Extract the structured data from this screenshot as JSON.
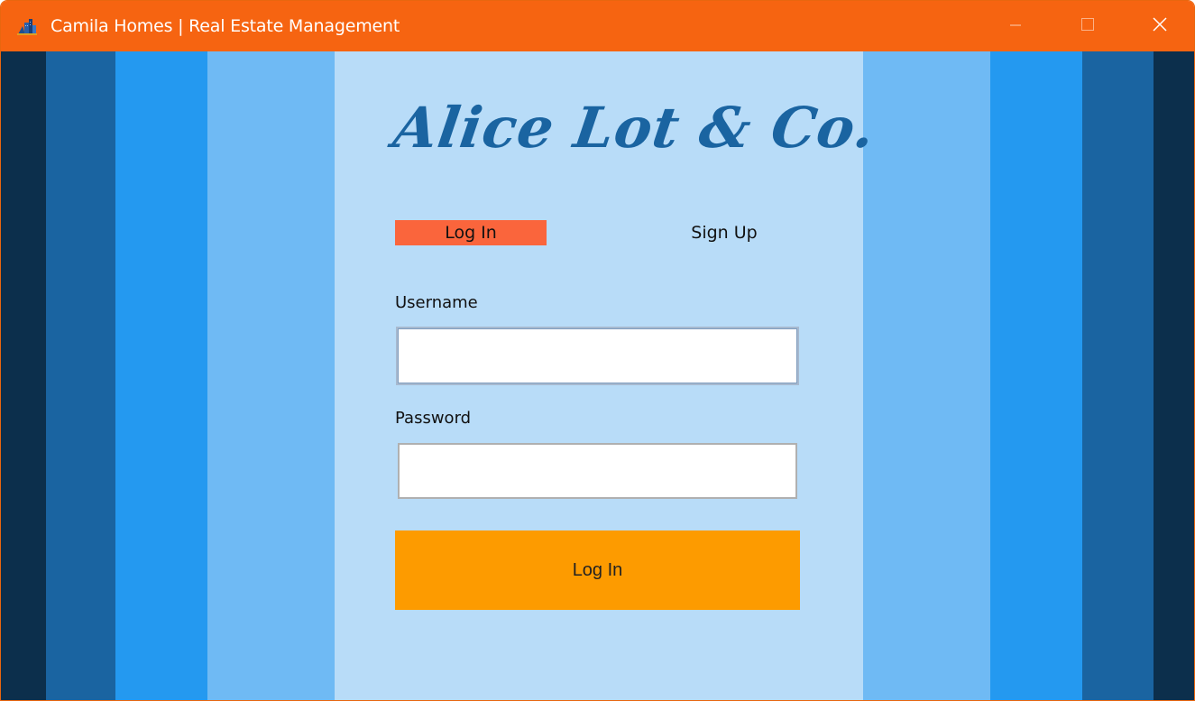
{
  "window": {
    "title": "Camila Homes | Real Estate Management",
    "controls": {
      "minimize_icon": "minimize-icon",
      "maximize_icon": "maximize-icon",
      "close_icon": "close-icon"
    },
    "accent_color": "#f66411"
  },
  "brand": {
    "text": "Alice Lot & Co.",
    "color": "#1a64a1"
  },
  "tabs": {
    "login_label": "Log In",
    "signup_label": "Sign Up",
    "active": "Log In",
    "active_color": "#fa653c"
  },
  "form": {
    "username_label": "Username",
    "username_value": "",
    "password_label": "Password",
    "password_value": "",
    "submit_label": "Log In",
    "submit_color": "#fd9b00"
  },
  "background_stripes": [
    "#0c2f4c",
    "#1a64a1",
    "#2499f0",
    "#6fbaf4",
    "#b8dcf8"
  ]
}
